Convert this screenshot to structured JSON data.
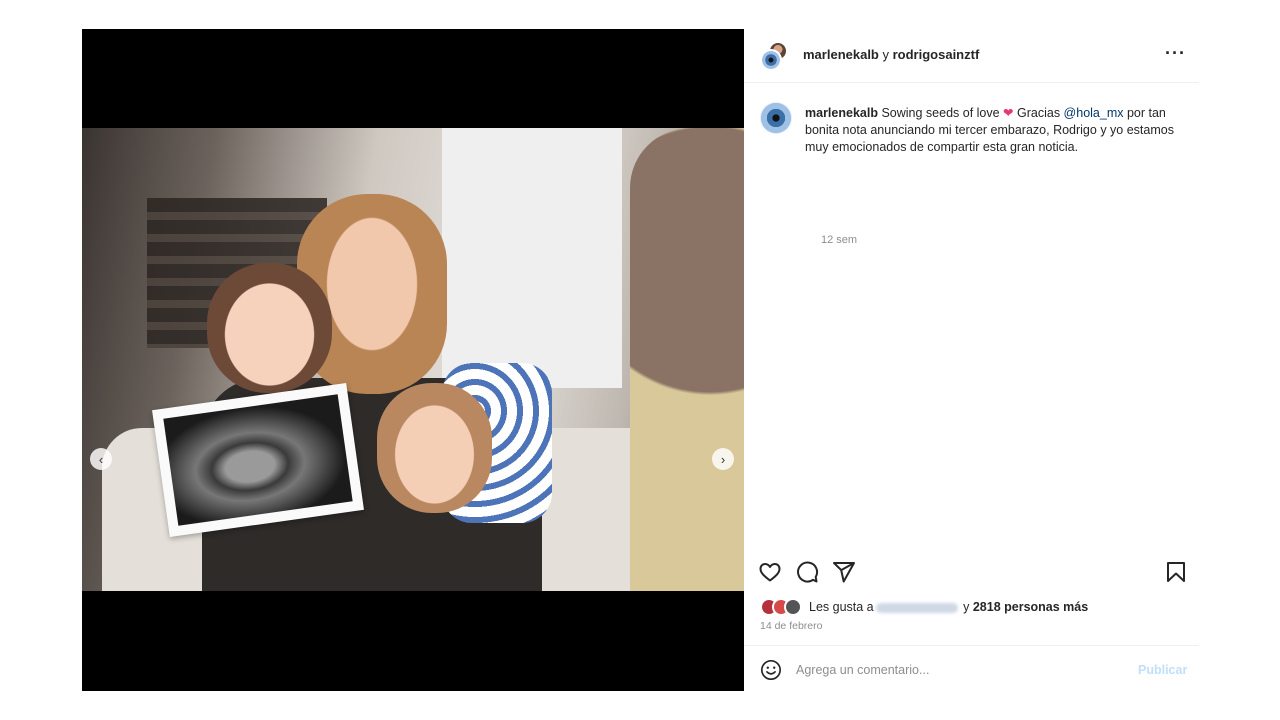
{
  "post": {
    "media": {
      "image_alt": "Family photo with ultrasound",
      "carousel": {
        "total": 8,
        "active": 0
      }
    },
    "nav": {
      "prev_glyph": "‹",
      "next_glyph": "›"
    },
    "header": {
      "user1": "marlenekalb",
      "connector": " y ",
      "user2": "rodrigosainztf",
      "more_glyph": "···"
    },
    "caption": {
      "user": "marlenekalb",
      "text_before": " Sowing seeds of love ",
      "heart": "❤",
      "text_middle": " Gracias ",
      "mention": "@hola_mx",
      "text_after": " por tan bonita nota anunciando mi tercer embarazo, Rodrigo y yo estamos muy emocionados de compartir esta gran noticia.",
      "time": "12 sem"
    },
    "likes": {
      "prefix": "Les gusta a",
      "connector": " y ",
      "others": "2818 personas más"
    },
    "date": "14 de febrero",
    "comment": {
      "placeholder": "Agrega un comentario...",
      "publish_label": "Publicar"
    }
  },
  "colors": {
    "link": "#00376b",
    "muted": "#8e8e8e",
    "publish_disabled": "#c0dffd",
    "heart": "#e8386d",
    "active_dot": "#3897f0"
  },
  "icons": [
    "heart-icon",
    "comment-icon",
    "share-icon",
    "bookmark-icon",
    "emoji-icon",
    "more-icon",
    "chevron-left-icon",
    "chevron-right-icon"
  ]
}
